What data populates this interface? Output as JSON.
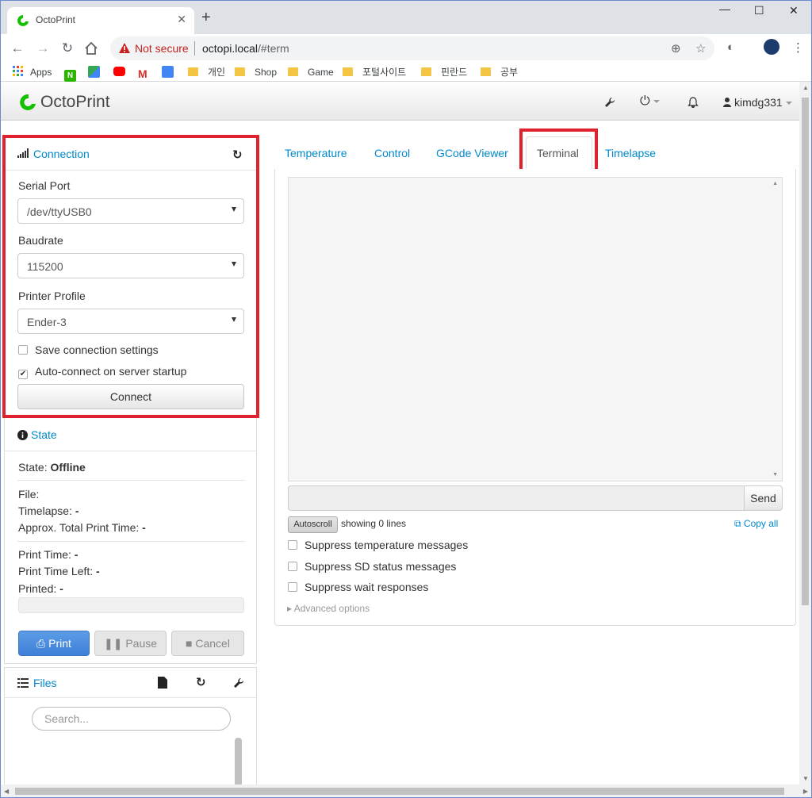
{
  "browser": {
    "tab_title": "OctoPrint",
    "tab_close": "✕",
    "new_tab": "+",
    "not_secure": "Not secure",
    "url_host": "octopi.local",
    "url_path": "/#term",
    "window_controls": [
      "—",
      "☐",
      "✕"
    ]
  },
  "bookmarks": [
    {
      "label": "Apps",
      "kind": "apps"
    },
    {
      "label": "",
      "kind": "naver"
    },
    {
      "label": "",
      "kind": "maps"
    },
    {
      "label": "",
      "kind": "youtube"
    },
    {
      "label": "",
      "kind": "gmail"
    },
    {
      "label": "",
      "kind": "translate"
    },
    {
      "label": "개인",
      "kind": "folder"
    },
    {
      "label": "Shop",
      "kind": "folder"
    },
    {
      "label": "Game",
      "kind": "folder"
    },
    {
      "label": "포털사이트",
      "kind": "folder"
    },
    {
      "label": "핀란드",
      "kind": "folder"
    },
    {
      "label": "공부",
      "kind": "folder"
    }
  ],
  "navbar": {
    "brand": "OctoPrint",
    "user": "kimdg331"
  },
  "connection": {
    "title": "Connection",
    "serial_port_label": "Serial Port",
    "serial_port_value": "/dev/ttyUSB0",
    "baudrate_label": "Baudrate",
    "baudrate_value": "115200",
    "profile_label": "Printer Profile",
    "profile_value": "Ender-3",
    "save_settings_label": "Save connection settings",
    "save_settings_checked": false,
    "autoconnect_label": "Auto-connect on server startup",
    "autoconnect_checked": true,
    "connect_button": "Connect"
  },
  "state": {
    "title": "State",
    "state_label": "State:",
    "state_value": "Offline",
    "file_label": "File:",
    "timelapse_label": "Timelapse:",
    "timelapse_value": "-",
    "approx_label": "Approx. Total Print Time:",
    "approx_value": "-",
    "print_time_label": "Print Time:",
    "print_time_value": "-",
    "time_left_label": "Print Time Left:",
    "time_left_value": "-",
    "printed_label": "Printed:",
    "printed_value": "-",
    "print_button": "Print",
    "pause_button": "Pause",
    "cancel_button": "Cancel"
  },
  "files": {
    "title": "Files",
    "search_placeholder": "Search..."
  },
  "tabs": [
    {
      "label": "Temperature",
      "active": false
    },
    {
      "label": "Control",
      "active": false
    },
    {
      "label": "GCode Viewer",
      "active": false
    },
    {
      "label": "Terminal",
      "active": true
    },
    {
      "label": "Timelapse",
      "active": false
    }
  ],
  "terminal": {
    "send_button": "Send",
    "autoscroll_button": "Autoscroll",
    "showing_lines": "showing 0 lines",
    "copy_all": "Copy all",
    "options": [
      {
        "label": "Suppress temperature messages",
        "checked": false
      },
      {
        "label": "Suppress SD status messages",
        "checked": false
      },
      {
        "label": "Suppress wait responses",
        "checked": false
      }
    ],
    "advanced_options": "Advanced options"
  },
  "colors": {
    "link": "#0088cc",
    "highlight": "#e0212e",
    "primary": "#3e7fd8"
  }
}
